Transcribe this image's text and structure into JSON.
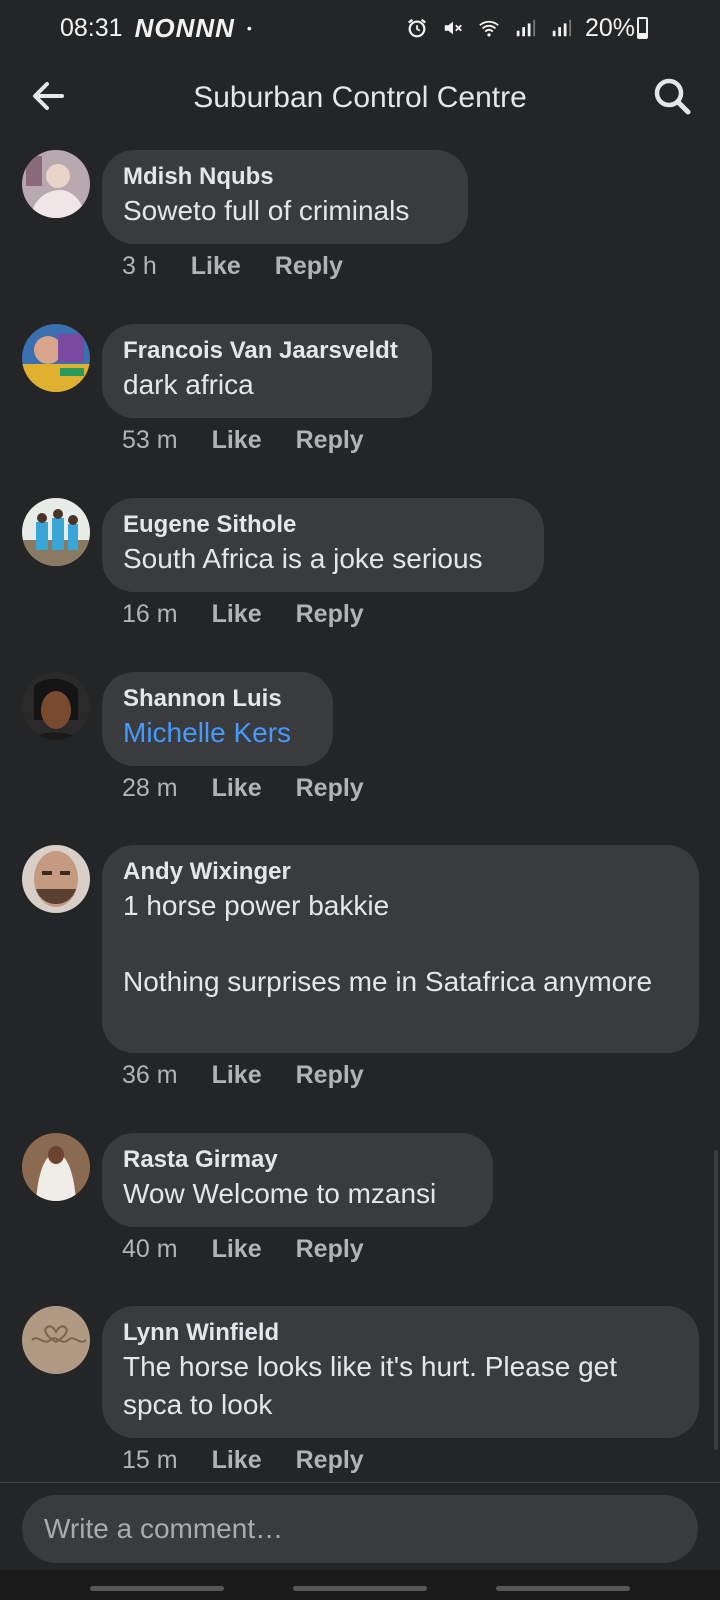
{
  "status_bar": {
    "time": "08:31",
    "app_indicators": "NONNN",
    "dot": "•",
    "battery_percent": "20%",
    "battery_level": 0.2,
    "icons": [
      "alarm-icon",
      "mute-icon",
      "wifi-icon",
      "signal-icon",
      "signal-icon",
      "battery-icon"
    ]
  },
  "header": {
    "title": "Suburban Control Centre",
    "back_icon": "arrow-left-icon",
    "search_icon": "search-icon"
  },
  "comments": [
    {
      "name": "Mdish Nqubs",
      "text": "Soweto full of criminals",
      "time": "3 h",
      "like": "Like",
      "reply": "Reply"
    },
    {
      "name": "Francois Van Jaarsveldt",
      "text": "dark africa",
      "time": "53 m",
      "like": "Like",
      "reply": "Reply"
    },
    {
      "name": "Eugene Sithole",
      "text": "South Africa is a joke serious",
      "time": "16 m",
      "like": "Like",
      "reply": "Reply"
    },
    {
      "name": "Shannon Luis",
      "text": "Michelle Kers",
      "time": "28 m",
      "like": "Like",
      "reply": "Reply",
      "mention": true
    },
    {
      "name": "Andy Wixinger",
      "text": "1 horse power bakkie\n\nNothing surprises me in Satafrica anymore",
      "time": "36 m",
      "like": "Like",
      "reply": "Reply"
    },
    {
      "name": "Rasta Girmay",
      "text": "Wow Welcome to mzansi",
      "time": "40 m",
      "like": "Like",
      "reply": "Reply"
    },
    {
      "name": "Lynn Winfield",
      "text": "The horse looks like it's hurt. Please get spca to look",
      "time": "15 m",
      "like": "Like",
      "reply": "Reply"
    }
  ],
  "composer": {
    "placeholder": "Write a comment…"
  },
  "colors": {
    "background": "#242526",
    "bubble": "#3a3b3c",
    "mention": "#4599ff",
    "meta": "#b0b3b8"
  }
}
